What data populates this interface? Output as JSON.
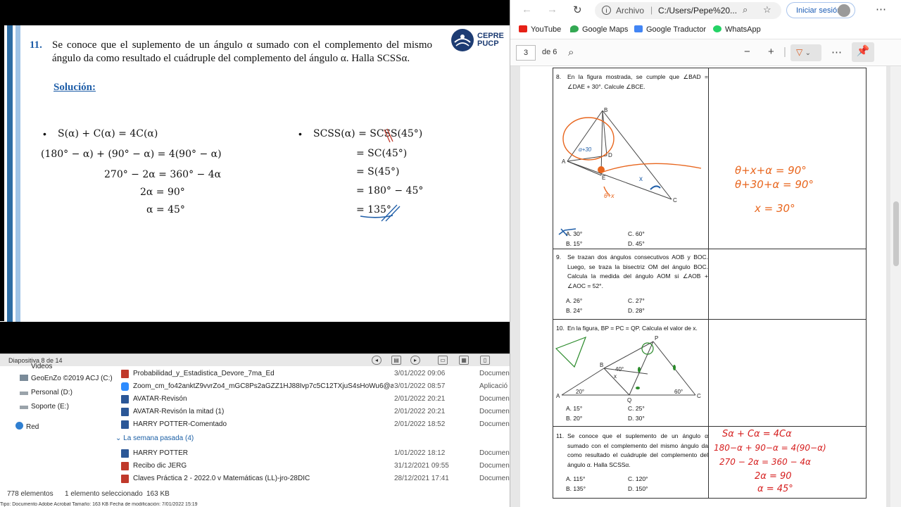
{
  "slide": {
    "problem_number": "11.",
    "problem_text": "Se conoce que el suplemento de un ángulo α sumado con el complemento del mismo ángulo da como resultado el cuádruple del complemento del ángulo α. Halla SCSSα.",
    "solution_label": "Solución:",
    "logo_line1": "CEPRE",
    "logo_line2": "PUCP",
    "left_eqs": [
      "S(α) + C(α)  =  4C(α)",
      "(180° − α) + (90° − α)  =  4(90° − α)",
      "270° − 2α = 360° − 4α",
      "2α = 90°",
      "α = 45°"
    ],
    "right_eqs": [
      "SCSS(α) = SCSS(45°)",
      "= SC(45°)",
      "= S(45°)",
      "= 180° − 45°",
      "= 135°"
    ],
    "bullet": "•"
  },
  "ppt_status": {
    "slide_info": "Diapositiva 8 de 14"
  },
  "explorer": {
    "tree": [
      {
        "label": "Videos",
        "icon": "folder-icon"
      },
      {
        "label": "GeoEnZo ©2019 ACJ (C:)",
        "icon": "drive-icon"
      },
      {
        "label": "Personal (D:)",
        "icon": "drive-icon"
      },
      {
        "label": "Soporte (E:)",
        "icon": "drive-icon"
      },
      {
        "label": "Red",
        "icon": "network-icon"
      }
    ],
    "files_top": [
      {
        "name": "Probabilidad_y_Estadistica_Devore_7ma_Ed",
        "date": "3/01/2022 09:06",
        "type": "Documen",
        "icon": "pdf-icon",
        "color": "#c0392b"
      },
      {
        "name": "Zoom_cm_fo42anktZ9vvrZo4_mGC8Ps2aGZZ1HJ88Ivp7c5C12TXjuS4sHoWu6@a...",
        "date": "3/01/2022 08:57",
        "type": "Aplicació",
        "icon": "zoom-icon",
        "color": "#2d8cff"
      },
      {
        "name": "AVATAR-Revisón",
        "date": "2/01/2022 20:21",
        "type": "Documen",
        "icon": "word-icon",
        "color": "#2b5797"
      },
      {
        "name": "AVATAR-Revisón la mitad (1)",
        "date": "2/01/2022 20:21",
        "type": "Documen",
        "icon": "word-icon",
        "color": "#2b5797"
      },
      {
        "name": "HARRY POTTER-Comentado",
        "date": "2/01/2022 18:52",
        "type": "Documen",
        "icon": "word-icon",
        "color": "#2b5797"
      }
    ],
    "group_label": "La semana pasada (4)",
    "files_bottom": [
      {
        "name": "HARRY POTTER",
        "date": "1/01/2022 18:12",
        "type": "Documen",
        "icon": "word-icon",
        "color": "#2b5797"
      },
      {
        "name": "Recibo dic JERG",
        "date": "31/12/2021 09:55",
        "type": "Documen",
        "icon": "pdf-icon",
        "color": "#c0392b"
      },
      {
        "name": "Claves Práctica 2 - 2022.0 v Matemáticas (LL)-jro-28DIC",
        "date": "28/12/2021 17:41",
        "type": "Documen",
        "icon": "pdf-icon",
        "color": "#c0392b"
      }
    ],
    "status_count": "778 elementos",
    "status_selected": "1 elemento seleccionado",
    "status_size": "163 KB",
    "footer": "Tipo: Documento Adobe Acrobat  Tamaño: 163 KB  Fecha de modificación: 7/01/2022 15:19"
  },
  "browser": {
    "archivo": "Archivo",
    "separator": "|",
    "url": "C:/Users/Pepe%20...",
    "signin": "Iniciar sesión",
    "bookmarks": [
      {
        "label": "YouTube",
        "color": "#e62117",
        "icon": "youtube-icon"
      },
      {
        "label": "Google Maps",
        "color": "#34a853",
        "icon": "maps-icon"
      },
      {
        "label": "Google Traductor",
        "color": "#4285f4",
        "icon": "translate-icon"
      },
      {
        "label": "WhatsApp",
        "color": "#25d366",
        "icon": "whatsapp-icon"
      }
    ],
    "page_current": "3",
    "page_total": "de 6"
  },
  "pdf": {
    "q8": {
      "num": "8.",
      "text": "En la figura mostrada, se cumple que ∠BAD = ∠DAE + 30°. Calcule ∠BCE.",
      "options": [
        "A. 30°",
        "C. 60°",
        "B. 15°",
        "D. 45°"
      ]
    },
    "q9": {
      "num": "9.",
      "text": "Se trazan dos ángulos consecutivos AOB y BOC. Luego, se traza la bisectriz OM del ángulo BOC. Calcula la medida del ángulo AOM si ∠AOB + ∠AOC = 52°.",
      "options": [
        "A. 26°",
        "C. 27°",
        "B. 24°",
        "D. 28°"
      ]
    },
    "q10": {
      "num": "10.",
      "text": "En la figura, BP = PC = QP. Calcula el valor de x.",
      "options": [
        "A. 15°",
        "C. 25°",
        "B. 20°",
        "D. 30°"
      ],
      "labels": [
        "P",
        "B",
        "40°",
        "x",
        "A",
        "20°",
        "Q",
        "60°",
        "C"
      ]
    },
    "q11": {
      "num": "11.",
      "text": "Se conoce que el suplemento de un ángulo α sumado con el complemento del mismo ángulo da como resultado el cuádruple del complemento del ángulo α. Halla SCSSα.",
      "options": [
        "A. 115°",
        "C. 120°",
        "B. 135°",
        "D. 150°"
      ]
    },
    "fig8_labels": [
      "B",
      "A",
      "D",
      "E",
      "C"
    ],
    "hand8": [
      "θ+x+α = 90°",
      "θ+30+α = 90°",
      "x = 30°",
      "θ+x",
      "α+30"
    ],
    "hand11": [
      "Sα + Cα = 4Cα",
      "180−α + 90−α = 4(90−α)",
      "270 − 2α = 360 − 4α",
      "2α = 90",
      "α = 45°"
    ]
  }
}
